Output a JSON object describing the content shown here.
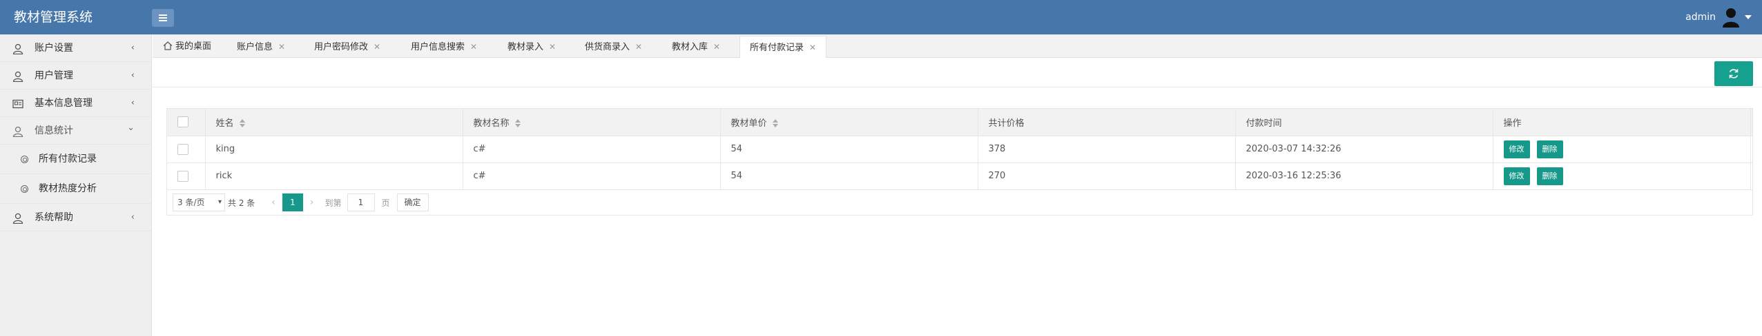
{
  "app": {
    "title": "教材管理系统"
  },
  "header": {
    "user": "admin"
  },
  "sidebar": {
    "items": [
      {
        "label": "账户设置",
        "icon": "user-icon",
        "arrow": "‹"
      },
      {
        "label": "用户管理",
        "icon": "user-icon",
        "arrow": "‹"
      },
      {
        "label": "基本信息管理",
        "icon": "card-icon",
        "arrow": "‹"
      },
      {
        "label": "信息统计",
        "icon": "user-icon",
        "arrow": "⌄"
      }
    ],
    "sub_items": [
      {
        "label": "所有付款记录"
      },
      {
        "label": "教材热度分析"
      }
    ],
    "last_item": {
      "label": "系统帮助",
      "icon": "user-icon",
      "arrow": "‹"
    }
  },
  "tabs": [
    {
      "label": "我的桌面"
    },
    {
      "label": "账户信息"
    },
    {
      "label": "用户密码修改"
    },
    {
      "label": "用户信息搜索"
    },
    {
      "label": "教材录入"
    },
    {
      "label": "供货商录入"
    },
    {
      "label": "教材入库"
    },
    {
      "label": "所有付款记录"
    }
  ],
  "tab_close": "✕",
  "table": {
    "headers": [
      "姓名",
      "教材名称",
      "教材单价",
      "共计价格",
      "付款时间",
      "操作"
    ],
    "rows": [
      {
        "name": "king",
        "book": "c#",
        "price": "54",
        "total": "378",
        "time": "2020-03-07 14:32:26"
      },
      {
        "name": "rick",
        "book": "c#",
        "price": "54",
        "total": "270",
        "time": "2020-03-16 12:25:36"
      }
    ],
    "edit_label": "修改",
    "delete_label": "删除"
  },
  "pager": {
    "page_size": "3 条/页",
    "total": "共 2 条",
    "current": "1",
    "goto_label": "到第",
    "goto_value": "1",
    "unit": "页",
    "ok": "确定",
    "prev": "‹",
    "next": "›"
  },
  "colors": {
    "header": "#4676aa",
    "accent": "#16998a"
  }
}
